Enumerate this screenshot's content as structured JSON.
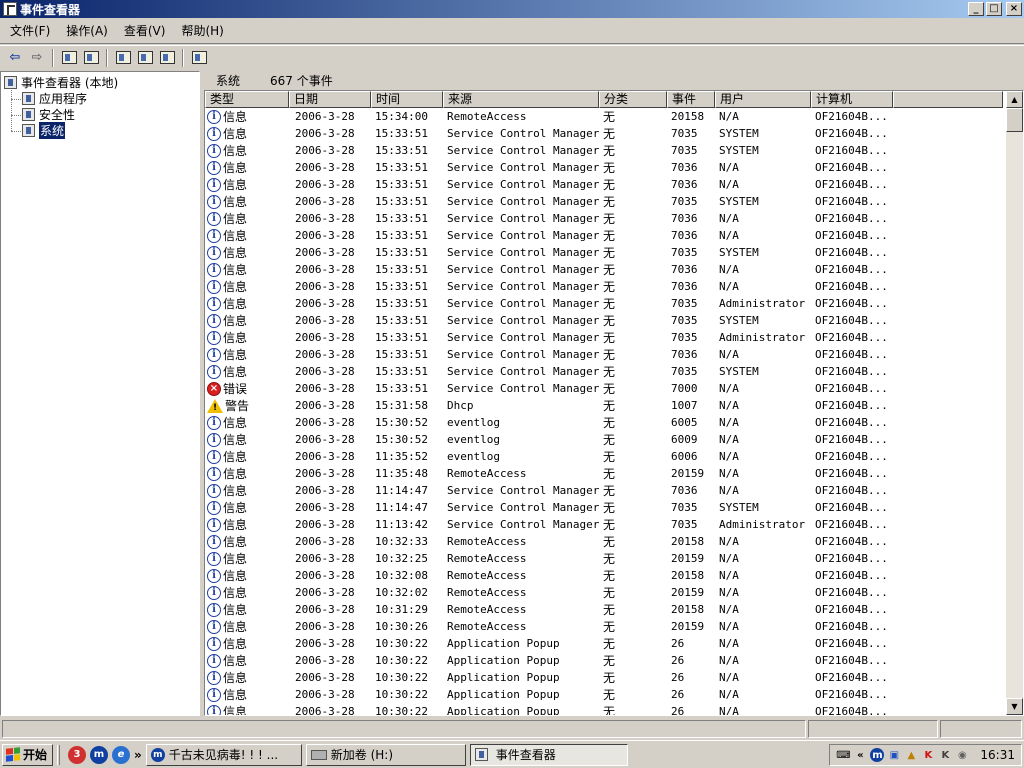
{
  "window": {
    "title": "事件查看器",
    "minimize": "_",
    "maximize": "□",
    "close": "×"
  },
  "menu": [
    "文件(F)",
    "操作(A)",
    "查看(V)",
    "帮助(H)"
  ],
  "tree": {
    "root": "事件查看器 (本地)",
    "items": [
      {
        "label": "应用程序",
        "selected": false
      },
      {
        "label": "安全性",
        "selected": false
      },
      {
        "label": "系统",
        "selected": true
      }
    ]
  },
  "list_header": {
    "log_name": "系统",
    "count": "667 个事件"
  },
  "columns": [
    "类型",
    "日期",
    "时间",
    "来源",
    "分类",
    "事件",
    "用户",
    "计算机"
  ],
  "rows": [
    {
      "type": "信息",
      "kind": "info",
      "date": "2006-3-28",
      "time": "15:34:00",
      "source": "RemoteAccess",
      "category": "无",
      "event": "20158",
      "user": "N/A",
      "computer": "OF21604B..."
    },
    {
      "type": "信息",
      "kind": "info",
      "date": "2006-3-28",
      "time": "15:33:51",
      "source": "Service Control Manager",
      "category": "无",
      "event": "7035",
      "user": "SYSTEM",
      "computer": "OF21604B..."
    },
    {
      "type": "信息",
      "kind": "info",
      "date": "2006-3-28",
      "time": "15:33:51",
      "source": "Service Control Manager",
      "category": "无",
      "event": "7035",
      "user": "SYSTEM",
      "computer": "OF21604B..."
    },
    {
      "type": "信息",
      "kind": "info",
      "date": "2006-3-28",
      "time": "15:33:51",
      "source": "Service Control Manager",
      "category": "无",
      "event": "7036",
      "user": "N/A",
      "computer": "OF21604B..."
    },
    {
      "type": "信息",
      "kind": "info",
      "date": "2006-3-28",
      "time": "15:33:51",
      "source": "Service Control Manager",
      "category": "无",
      "event": "7036",
      "user": "N/A",
      "computer": "OF21604B..."
    },
    {
      "type": "信息",
      "kind": "info",
      "date": "2006-3-28",
      "time": "15:33:51",
      "source": "Service Control Manager",
      "category": "无",
      "event": "7035",
      "user": "SYSTEM",
      "computer": "OF21604B..."
    },
    {
      "type": "信息",
      "kind": "info",
      "date": "2006-3-28",
      "time": "15:33:51",
      "source": "Service Control Manager",
      "category": "无",
      "event": "7036",
      "user": "N/A",
      "computer": "OF21604B..."
    },
    {
      "type": "信息",
      "kind": "info",
      "date": "2006-3-28",
      "time": "15:33:51",
      "source": "Service Control Manager",
      "category": "无",
      "event": "7036",
      "user": "N/A",
      "computer": "OF21604B..."
    },
    {
      "type": "信息",
      "kind": "info",
      "date": "2006-3-28",
      "time": "15:33:51",
      "source": "Service Control Manager",
      "category": "无",
      "event": "7035",
      "user": "SYSTEM",
      "computer": "OF21604B..."
    },
    {
      "type": "信息",
      "kind": "info",
      "date": "2006-3-28",
      "time": "15:33:51",
      "source": "Service Control Manager",
      "category": "无",
      "event": "7036",
      "user": "N/A",
      "computer": "OF21604B..."
    },
    {
      "type": "信息",
      "kind": "info",
      "date": "2006-3-28",
      "time": "15:33:51",
      "source": "Service Control Manager",
      "category": "无",
      "event": "7036",
      "user": "N/A",
      "computer": "OF21604B..."
    },
    {
      "type": "信息",
      "kind": "info",
      "date": "2006-3-28",
      "time": "15:33:51",
      "source": "Service Control Manager",
      "category": "无",
      "event": "7035",
      "user": "Administrator",
      "computer": "OF21604B..."
    },
    {
      "type": "信息",
      "kind": "info",
      "date": "2006-3-28",
      "time": "15:33:51",
      "source": "Service Control Manager",
      "category": "无",
      "event": "7035",
      "user": "SYSTEM",
      "computer": "OF21604B..."
    },
    {
      "type": "信息",
      "kind": "info",
      "date": "2006-3-28",
      "time": "15:33:51",
      "source": "Service Control Manager",
      "category": "无",
      "event": "7035",
      "user": "Administrator",
      "computer": "OF21604B..."
    },
    {
      "type": "信息",
      "kind": "info",
      "date": "2006-3-28",
      "time": "15:33:51",
      "source": "Service Control Manager",
      "category": "无",
      "event": "7036",
      "user": "N/A",
      "computer": "OF21604B..."
    },
    {
      "type": "信息",
      "kind": "info",
      "date": "2006-3-28",
      "time": "15:33:51",
      "source": "Service Control Manager",
      "category": "无",
      "event": "7035",
      "user": "SYSTEM",
      "computer": "OF21604B..."
    },
    {
      "type": "错误",
      "kind": "error",
      "date": "2006-3-28",
      "time": "15:33:51",
      "source": "Service Control Manager",
      "category": "无",
      "event": "7000",
      "user": "N/A",
      "computer": "OF21604B..."
    },
    {
      "type": "警告",
      "kind": "warning",
      "date": "2006-3-28",
      "time": "15:31:58",
      "source": "Dhcp",
      "category": "无",
      "event": "1007",
      "user": "N/A",
      "computer": "OF21604B..."
    },
    {
      "type": "信息",
      "kind": "info",
      "date": "2006-3-28",
      "time": "15:30:52",
      "source": "eventlog",
      "category": "无",
      "event": "6005",
      "user": "N/A",
      "computer": "OF21604B..."
    },
    {
      "type": "信息",
      "kind": "info",
      "date": "2006-3-28",
      "time": "15:30:52",
      "source": "eventlog",
      "category": "无",
      "event": "6009",
      "user": "N/A",
      "computer": "OF21604B..."
    },
    {
      "type": "信息",
      "kind": "info",
      "date": "2006-3-28",
      "time": "11:35:52",
      "source": "eventlog",
      "category": "无",
      "event": "6006",
      "user": "N/A",
      "computer": "OF21604B..."
    },
    {
      "type": "信息",
      "kind": "info",
      "date": "2006-3-28",
      "time": "11:35:48",
      "source": "RemoteAccess",
      "category": "无",
      "event": "20159",
      "user": "N/A",
      "computer": "OF21604B..."
    },
    {
      "type": "信息",
      "kind": "info",
      "date": "2006-3-28",
      "time": "11:14:47",
      "source": "Service Control Manager",
      "category": "无",
      "event": "7036",
      "user": "N/A",
      "computer": "OF21604B..."
    },
    {
      "type": "信息",
      "kind": "info",
      "date": "2006-3-28",
      "time": "11:14:47",
      "source": "Service Control Manager",
      "category": "无",
      "event": "7035",
      "user": "SYSTEM",
      "computer": "OF21604B..."
    },
    {
      "type": "信息",
      "kind": "info",
      "date": "2006-3-28",
      "time": "11:13:42",
      "source": "Service Control Manager",
      "category": "无",
      "event": "7035",
      "user": "Administrator",
      "computer": "OF21604B..."
    },
    {
      "type": "信息",
      "kind": "info",
      "date": "2006-3-28",
      "time": "10:32:33",
      "source": "RemoteAccess",
      "category": "无",
      "event": "20158",
      "user": "N/A",
      "computer": "OF21604B..."
    },
    {
      "type": "信息",
      "kind": "info",
      "date": "2006-3-28",
      "time": "10:32:25",
      "source": "RemoteAccess",
      "category": "无",
      "event": "20159",
      "user": "N/A",
      "computer": "OF21604B..."
    },
    {
      "type": "信息",
      "kind": "info",
      "date": "2006-3-28",
      "time": "10:32:08",
      "source": "RemoteAccess",
      "category": "无",
      "event": "20158",
      "user": "N/A",
      "computer": "OF21604B..."
    },
    {
      "type": "信息",
      "kind": "info",
      "date": "2006-3-28",
      "time": "10:32:02",
      "source": "RemoteAccess",
      "category": "无",
      "event": "20159",
      "user": "N/A",
      "computer": "OF21604B..."
    },
    {
      "type": "信息",
      "kind": "info",
      "date": "2006-3-28",
      "time": "10:31:29",
      "source": "RemoteAccess",
      "category": "无",
      "event": "20158",
      "user": "N/A",
      "computer": "OF21604B..."
    },
    {
      "type": "信息",
      "kind": "info",
      "date": "2006-3-28",
      "time": "10:30:26",
      "source": "RemoteAccess",
      "category": "无",
      "event": "20159",
      "user": "N/A",
      "computer": "OF21604B..."
    },
    {
      "type": "信息",
      "kind": "info",
      "date": "2006-3-28",
      "time": "10:30:22",
      "source": "Application Popup",
      "category": "无",
      "event": "26",
      "user": "N/A",
      "computer": "OF21604B..."
    },
    {
      "type": "信息",
      "kind": "info",
      "date": "2006-3-28",
      "time": "10:30:22",
      "source": "Application Popup",
      "category": "无",
      "event": "26",
      "user": "N/A",
      "computer": "OF21604B..."
    },
    {
      "type": "信息",
      "kind": "info",
      "date": "2006-3-28",
      "time": "10:30:22",
      "source": "Application Popup",
      "category": "无",
      "event": "26",
      "user": "N/A",
      "computer": "OF21604B..."
    },
    {
      "type": "信息",
      "kind": "info",
      "date": "2006-3-28",
      "time": "10:30:22",
      "source": "Application Popup",
      "category": "无",
      "event": "26",
      "user": "N/A",
      "computer": "OF21604B..."
    },
    {
      "type": "信息",
      "kind": "info",
      "date": "2006-3-28",
      "time": "10:30:22",
      "source": "Application Popup",
      "category": "无",
      "event": "26",
      "user": "N/A",
      "computer": "OF21604B..."
    }
  ],
  "taskbar": {
    "start": "开始",
    "more": "»",
    "tasks": [
      {
        "label": "千古未见病毒! ! ! ...",
        "active": false
      },
      {
        "label": "新加卷 (H:)",
        "active": false
      },
      {
        "label": "事件查看器",
        "active": true
      }
    ],
    "tray_expand": "«",
    "clock": "16:31"
  },
  "colors": {
    "titlebar_start": "#0a246a",
    "titlebar_end": "#a6caf0",
    "selection": "#0a246a",
    "error": "#d82020",
    "warning": "#f0c000",
    "info": "#2040a0"
  }
}
